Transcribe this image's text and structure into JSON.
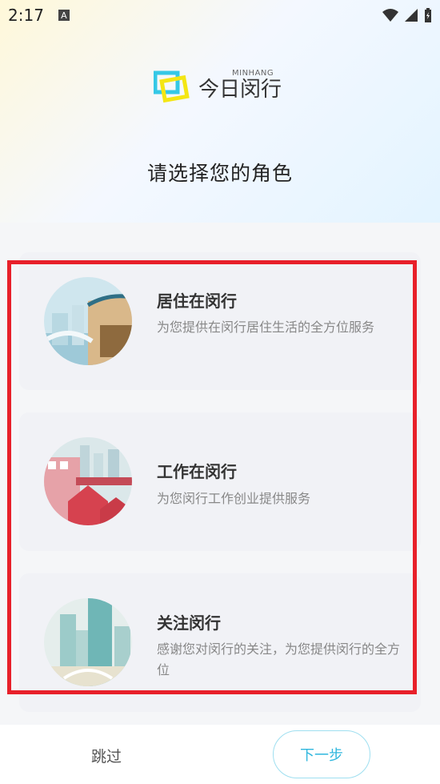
{
  "status_bar": {
    "time": "2:17",
    "notification_icon": "A"
  },
  "logo": {
    "english": "MINHANG",
    "chinese": "今日闵行"
  },
  "page_title": "请选择您的角色",
  "roles": [
    {
      "title": "居住在闵行",
      "description": "为您提供在闵行居住生活的全方位服务",
      "icon": "residential-illustration"
    },
    {
      "title": "工作在闵行",
      "description": "为您闵行工作创业提供服务",
      "icon": "work-illustration"
    },
    {
      "title": "关注闵行",
      "description": "感谢您对闵行的关注，为您提供闵行的全方位",
      "icon": "city-illustration"
    }
  ],
  "footer": {
    "skip_label": "跳过",
    "next_label": "下一步"
  },
  "colors": {
    "accent": "#2fb7de",
    "highlight": "#e8202a"
  }
}
